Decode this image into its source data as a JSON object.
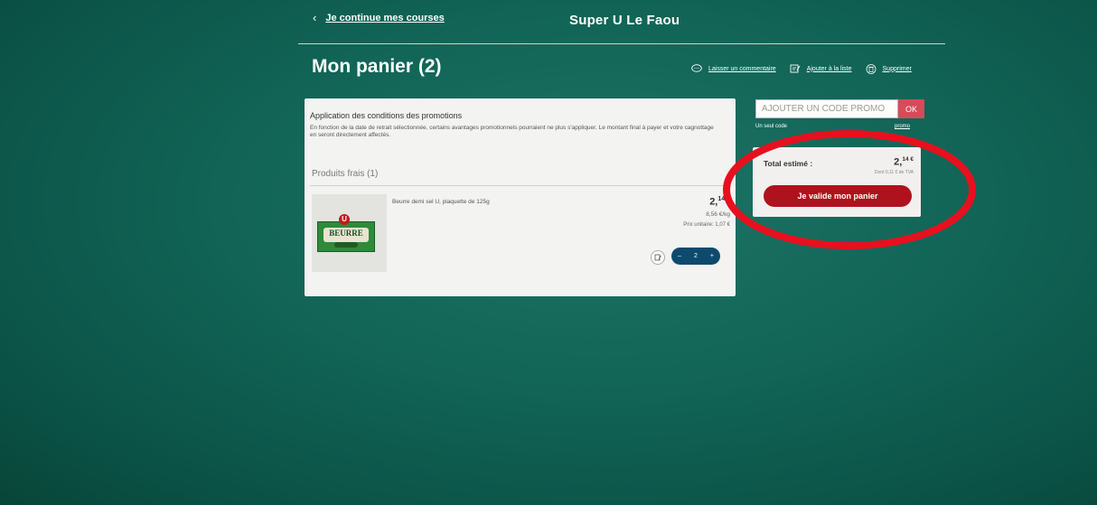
{
  "header": {
    "back_label": "Je continue mes courses",
    "store_name": "Super U Le Faou"
  },
  "page": {
    "title": "Mon panier (2)"
  },
  "actions": [
    {
      "label": "Laisser un commentaire",
      "icon": "comment-icon"
    },
    {
      "label": "Ajouter à la liste",
      "icon": "list-add-icon"
    },
    {
      "label": "Supprimer",
      "icon": "trash-icon"
    }
  ],
  "promotions_notice": {
    "title": "Application des conditions des promotions",
    "text": "En fonction de la date de retrait sélectionnée, certains avantages promotionnels pourraient ne plus s'appliquer. Le montant final à payer et votre cagnottage en seront directement affectés."
  },
  "section": {
    "label": "Produits frais (1)"
  },
  "product": {
    "name": "Beurre demi sel U, plaquette de 125g",
    "price_int": "2,",
    "price_dec": "14 €",
    "price_per_kg": "8,56 €/kg",
    "unit_price": "Prix unitaire: 1,07 €",
    "quantity": "2",
    "image_text": "BEURRE",
    "image_logo": "U"
  },
  "promo": {
    "placeholder": "AJOUTER UN CODE PROMO",
    "ok_label": "OK",
    "note": "Un seul code",
    "link": "promo"
  },
  "summary": {
    "total_label": "Total estimé :",
    "total_int": "2,",
    "total_dec": "14 €",
    "tva": "Dont 0,11 € de TVA",
    "validate_label": "Je valide mon panier"
  },
  "colors": {
    "background": "#116456",
    "validate_button": "#b0121d",
    "ok_button": "#d84a5a",
    "stepper": "#0e4a6e",
    "annotation": "#e8101e"
  }
}
